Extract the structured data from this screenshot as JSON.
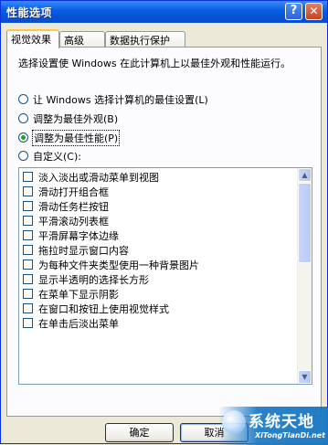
{
  "window": {
    "title": "性能选项",
    "help_label": "?",
    "close_label": "✕"
  },
  "tabs": [
    {
      "label": "视觉效果",
      "active": true
    },
    {
      "label": "高级",
      "active": false
    },
    {
      "label": "数据执行保护",
      "active": false
    }
  ],
  "visual_effects": {
    "description": "选择设置使 Windows 在此计算机上以最佳外观和性能运行。",
    "options": [
      {
        "label": "让 Windows 选择计算机的最佳设置(L)",
        "checked": false
      },
      {
        "label": "调整为最佳外观(B)",
        "checked": false
      },
      {
        "label": "调整为最佳性能(P)",
        "checked": true
      },
      {
        "label": "自定义(C):",
        "checked": false
      }
    ],
    "effects": [
      "淡入淡出或滑动菜单到视图",
      "滑动打开组合框",
      "滑动任务栏按钮",
      "平滑滚动列表框",
      "平滑屏幕字体边缘",
      "拖拉时显示窗口内容",
      "为每种文件夹类型使用一种背景图片",
      "显示半透明的选择长方形",
      "在菜单下显示阴影",
      "在窗口和按钮上使用视觉样式",
      "在单击后淡出菜单"
    ]
  },
  "buttons": {
    "ok": "确定",
    "cancel": "取消"
  },
  "watermark": {
    "text": "系统天地",
    "sub": "XiTongTianDi.net"
  }
}
